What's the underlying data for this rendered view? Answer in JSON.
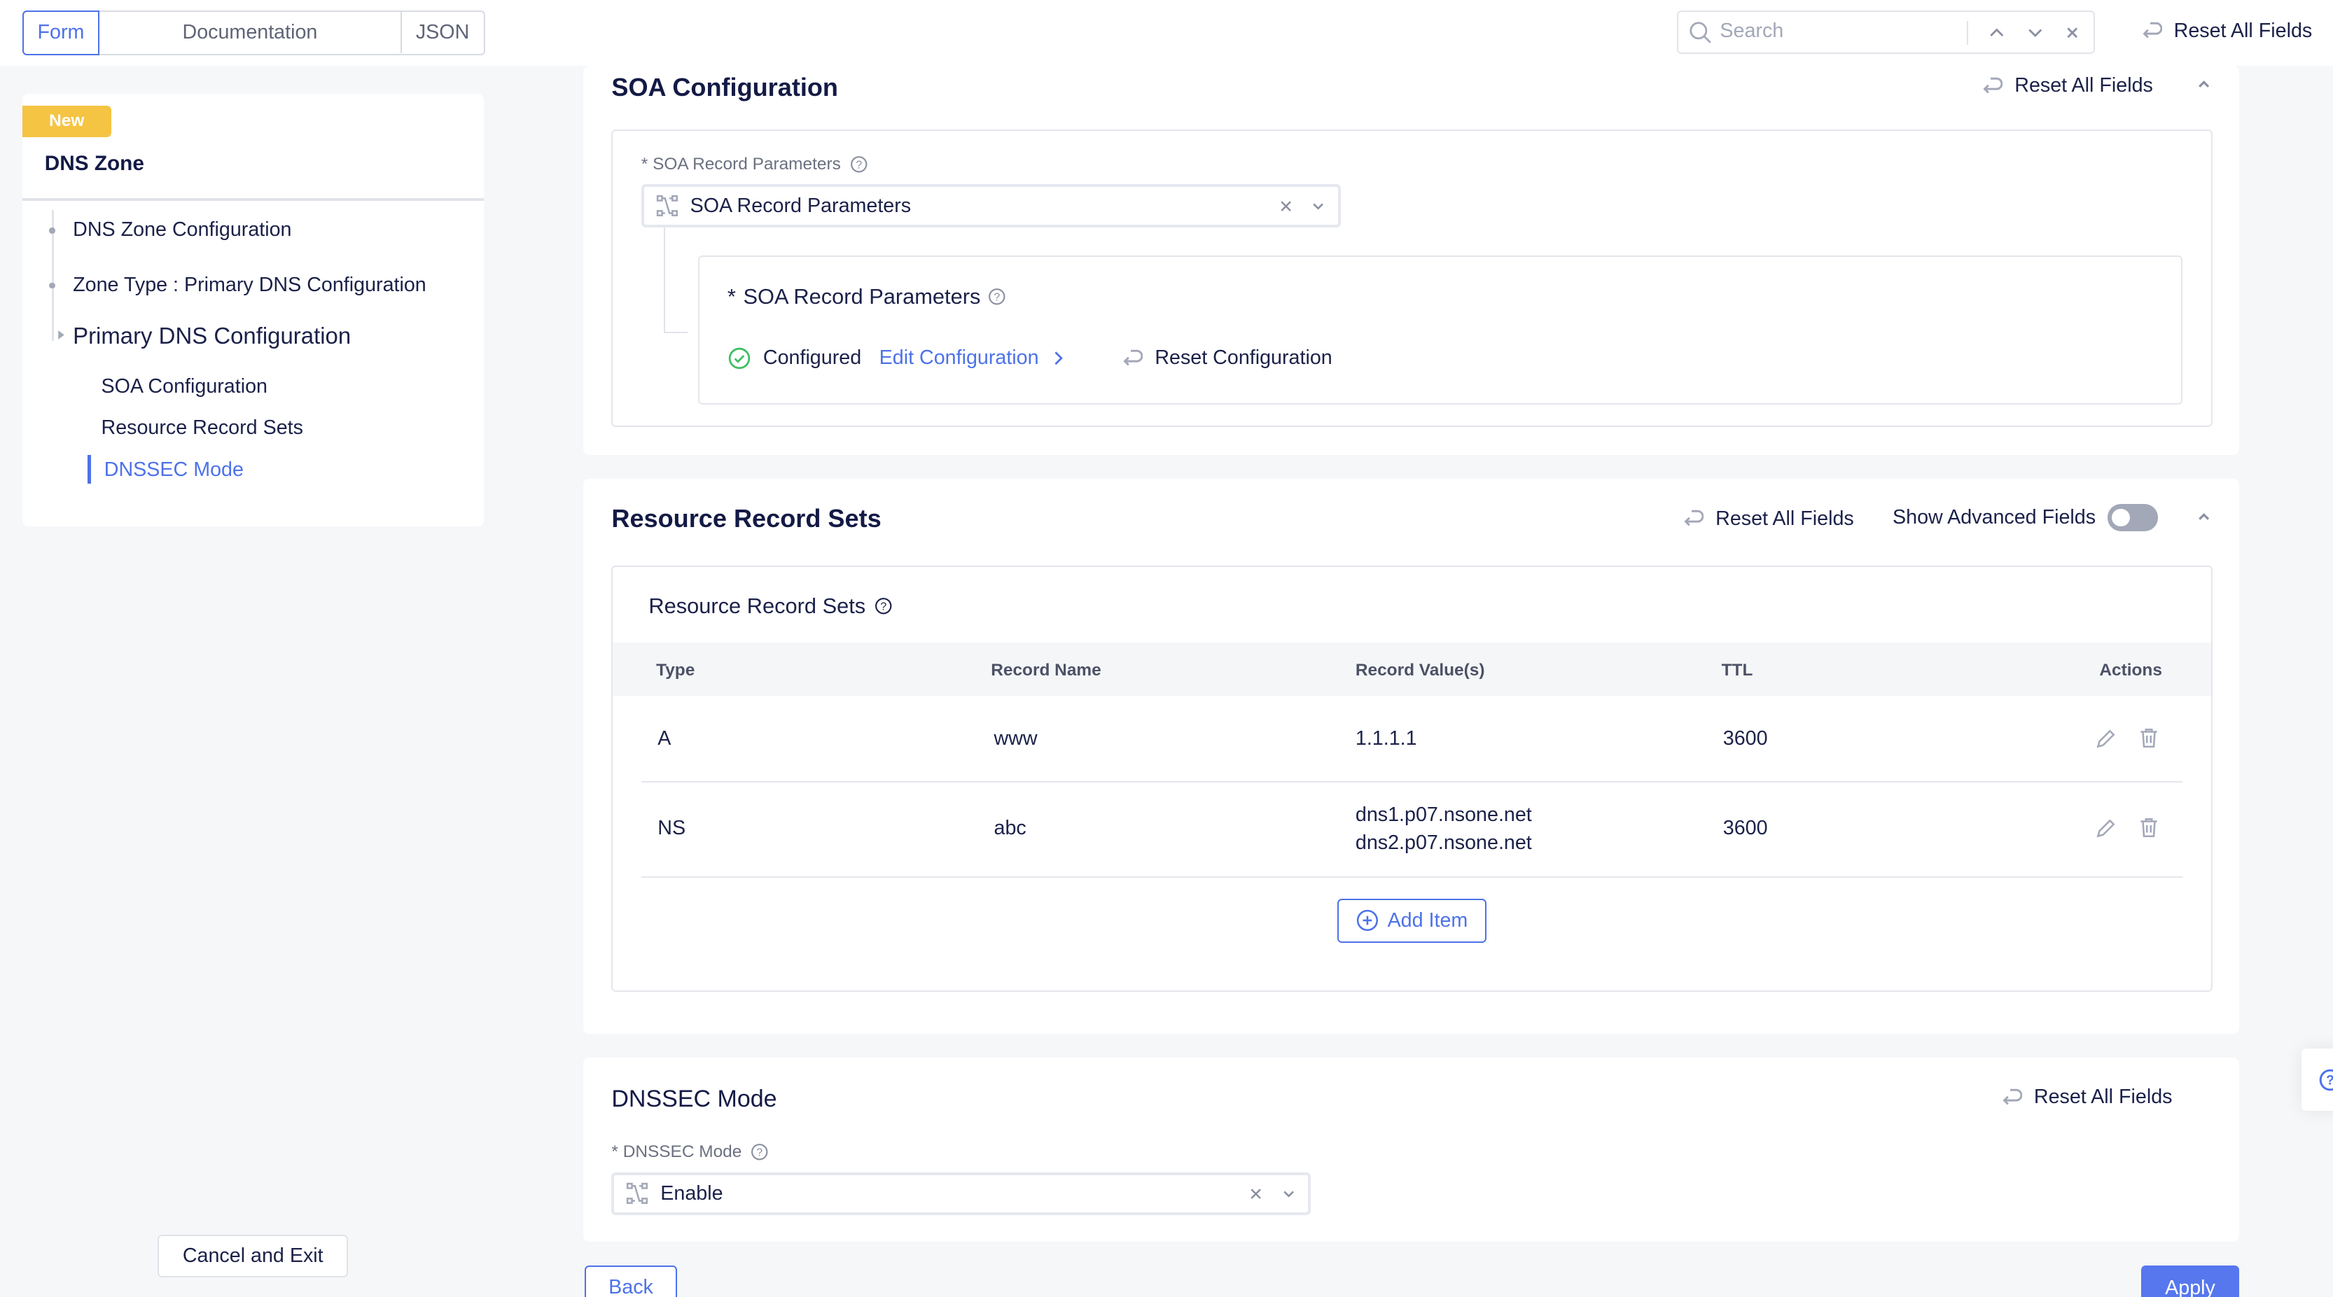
{
  "top": {
    "tabs": [
      {
        "label": "Form",
        "active": true
      },
      {
        "label": "Documentation"
      },
      {
        "label": "JSON"
      }
    ],
    "search_placeholder": "Search",
    "reset_all": "Reset All Fields"
  },
  "sidebar": {
    "badge": "New",
    "title": "DNS Zone",
    "items": [
      {
        "label": "DNS Zone Configuration"
      },
      {
        "label": "Zone Type : Primary DNS Configuration"
      },
      {
        "label": "Primary DNS Configuration"
      },
      {
        "label": "SOA Configuration"
      },
      {
        "label": "Resource Record Sets"
      },
      {
        "label": "DNSSEC Mode",
        "active": true
      }
    ],
    "cancel": "Cancel and Exit"
  },
  "soa": {
    "title": "SOA Configuration",
    "reset": "Reset All Fields",
    "field_label": "SOA Record Parameters",
    "required": "*",
    "value": "SOA Record Parameters",
    "nested": {
      "title": "SOA Record Parameters",
      "status": "Configured",
      "edit": "Edit Configuration",
      "reset": "Reset Configuration"
    }
  },
  "rrs": {
    "title": "Resource Record Sets",
    "reset": "Reset All Fields",
    "advanced_label": "Show Advanced Fields",
    "advanced_on": false,
    "table_title": "Resource Record Sets",
    "columns": [
      "Type",
      "Record Name",
      "Record Value(s)",
      "TTL",
      "Actions"
    ],
    "rows": [
      {
        "type": "A",
        "name": "www",
        "values": [
          "1.1.1.1"
        ],
        "ttl": "3600"
      },
      {
        "type": "NS",
        "name": "abc",
        "values": [
          "dns1.p07.nsone.net",
          "dns2.p07.nsone.net"
        ],
        "ttl": "3600"
      }
    ],
    "add_item": "Add Item"
  },
  "dnssec": {
    "title": "DNSSEC Mode",
    "reset": "Reset All Fields",
    "field_label": "DNSSEC Mode",
    "required": "*",
    "value": "Enable"
  },
  "footer": {
    "back": "Back",
    "apply": "Apply"
  },
  "colors": {
    "accent": "#4d72e8",
    "badge": "#f5c443",
    "success": "#3fbf5f",
    "navy": "#131a45"
  }
}
